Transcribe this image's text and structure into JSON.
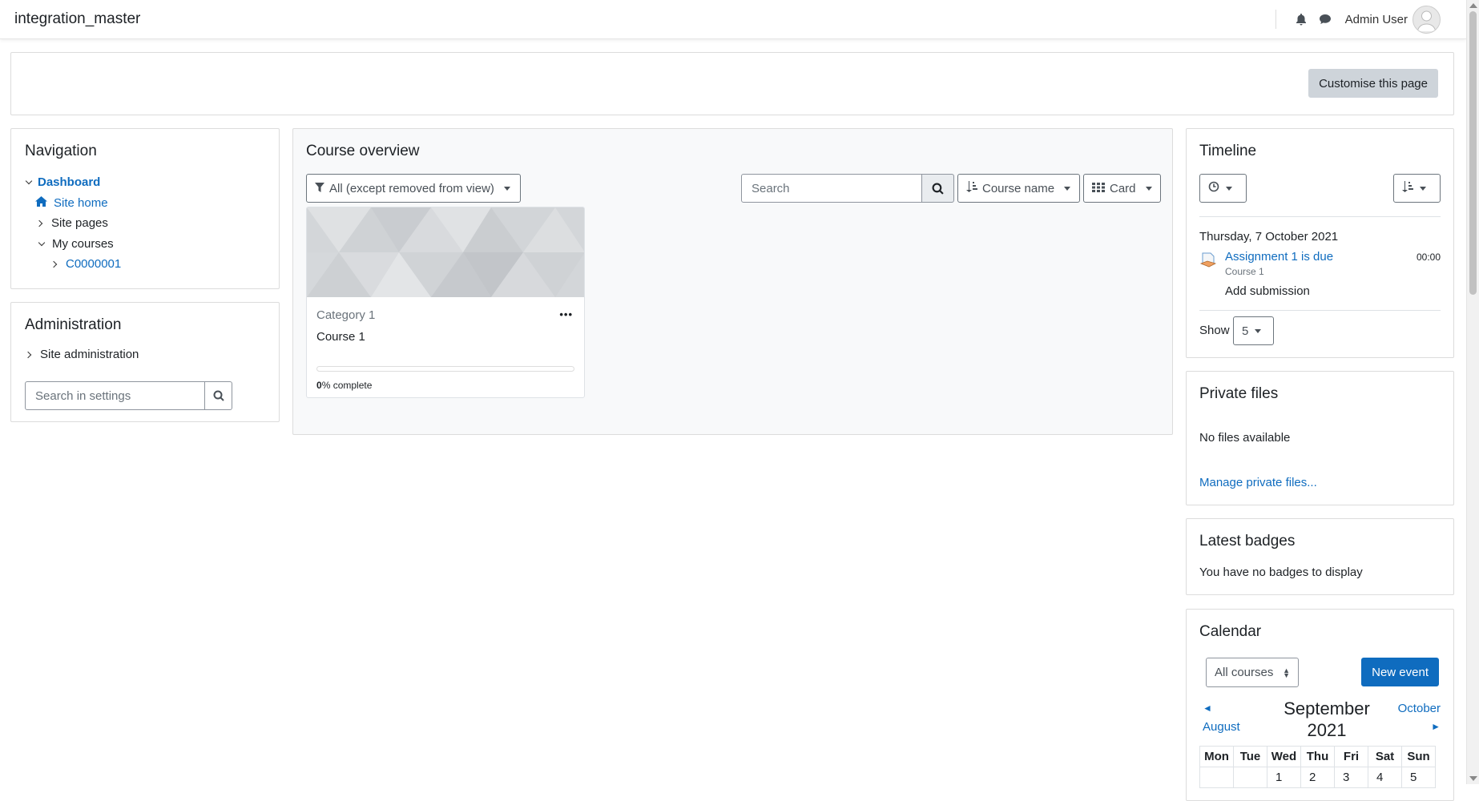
{
  "topbar": {
    "site_name": "integration_master",
    "user_name": "Admin User"
  },
  "header": {
    "customise_label": "Customise this page"
  },
  "navigation": {
    "title": "Navigation",
    "items": [
      {
        "label": "Dashboard"
      },
      {
        "label": "Site home"
      },
      {
        "label": "Site pages"
      },
      {
        "label": "My courses"
      },
      {
        "label": "C0000001"
      }
    ]
  },
  "administration": {
    "title": "Administration",
    "site_admin_label": "Site administration",
    "search_placeholder": "Search in settings"
  },
  "course_overview": {
    "title": "Course overview",
    "filter_label": "All (except removed from view)",
    "search_placeholder": "Search",
    "sort_label": "Course name",
    "view_label": "Card",
    "course": {
      "category": "Category 1",
      "name": "Course 1",
      "progress_percent": 0,
      "progress_value": "0",
      "progress_suffix": "% complete"
    }
  },
  "timeline": {
    "title": "Timeline",
    "date": "Thursday, 7 October 2021",
    "event": {
      "name": "Assignment 1 is due",
      "course": "Course 1",
      "time": "00:00",
      "action": "Add submission"
    },
    "show_label": "Show",
    "show_value": "5"
  },
  "private_files": {
    "title": "Private files",
    "empty_text": "No files available",
    "manage_link": "Manage private files..."
  },
  "latest_badges": {
    "title": "Latest badges",
    "empty_text": "You have no badges to display"
  },
  "calendar": {
    "title": "Calendar",
    "course_filter": "All courses",
    "new_event_label": "New event",
    "prev_month": "August",
    "next_month": "October",
    "month": "September",
    "year": "2021",
    "weekdays": [
      "Mon",
      "Tue",
      "Wed",
      "Thu",
      "Fri",
      "Sat",
      "Sun"
    ],
    "first_week": [
      "",
      "",
      "1",
      "2",
      "3",
      "4",
      "5"
    ],
    "accent_color": "#0f6cbf"
  }
}
